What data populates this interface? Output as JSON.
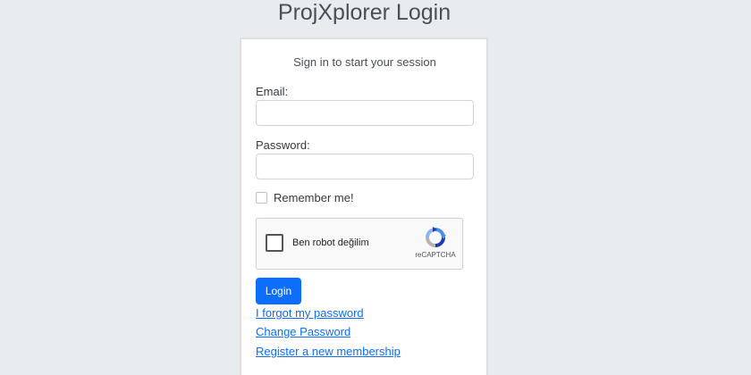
{
  "header": {
    "brand": "ProjXplorer",
    "title_suffix": "Login"
  },
  "login_box": {
    "subtitle": "Sign in to start your session",
    "email_label": "Email:",
    "email_value": "",
    "password_label": "Password:",
    "password_value": "",
    "remember_label": "Remember me!",
    "remember_checked": false,
    "login_button": "Login"
  },
  "recaptcha": {
    "label": "Ben robot değilim",
    "brand": "reCAPTCHA",
    "icon": "recaptcha-logo"
  },
  "links": {
    "forgot_password": "I forgot my password",
    "change_password": "Change Password",
    "register": "Register a new membership"
  },
  "colors": {
    "background": "#e9ecef",
    "primary": "#0d6efd"
  }
}
